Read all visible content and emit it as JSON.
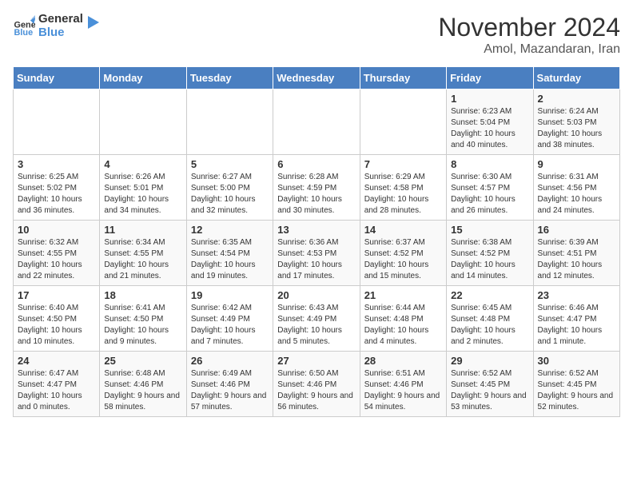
{
  "header": {
    "logo_general": "General",
    "logo_blue": "Blue",
    "month": "November 2024",
    "location": "Amol, Mazandaran, Iran"
  },
  "days_of_week": [
    "Sunday",
    "Monday",
    "Tuesday",
    "Wednesday",
    "Thursday",
    "Friday",
    "Saturday"
  ],
  "weeks": [
    [
      {
        "day": "",
        "info": ""
      },
      {
        "day": "",
        "info": ""
      },
      {
        "day": "",
        "info": ""
      },
      {
        "day": "",
        "info": ""
      },
      {
        "day": "",
        "info": ""
      },
      {
        "day": "1",
        "info": "Sunrise: 6:23 AM\nSunset: 5:04 PM\nDaylight: 10 hours and 40 minutes."
      },
      {
        "day": "2",
        "info": "Sunrise: 6:24 AM\nSunset: 5:03 PM\nDaylight: 10 hours and 38 minutes."
      }
    ],
    [
      {
        "day": "3",
        "info": "Sunrise: 6:25 AM\nSunset: 5:02 PM\nDaylight: 10 hours and 36 minutes."
      },
      {
        "day": "4",
        "info": "Sunrise: 6:26 AM\nSunset: 5:01 PM\nDaylight: 10 hours and 34 minutes."
      },
      {
        "day": "5",
        "info": "Sunrise: 6:27 AM\nSunset: 5:00 PM\nDaylight: 10 hours and 32 minutes."
      },
      {
        "day": "6",
        "info": "Sunrise: 6:28 AM\nSunset: 4:59 PM\nDaylight: 10 hours and 30 minutes."
      },
      {
        "day": "7",
        "info": "Sunrise: 6:29 AM\nSunset: 4:58 PM\nDaylight: 10 hours and 28 minutes."
      },
      {
        "day": "8",
        "info": "Sunrise: 6:30 AM\nSunset: 4:57 PM\nDaylight: 10 hours and 26 minutes."
      },
      {
        "day": "9",
        "info": "Sunrise: 6:31 AM\nSunset: 4:56 PM\nDaylight: 10 hours and 24 minutes."
      }
    ],
    [
      {
        "day": "10",
        "info": "Sunrise: 6:32 AM\nSunset: 4:55 PM\nDaylight: 10 hours and 22 minutes."
      },
      {
        "day": "11",
        "info": "Sunrise: 6:34 AM\nSunset: 4:55 PM\nDaylight: 10 hours and 21 minutes."
      },
      {
        "day": "12",
        "info": "Sunrise: 6:35 AM\nSunset: 4:54 PM\nDaylight: 10 hours and 19 minutes."
      },
      {
        "day": "13",
        "info": "Sunrise: 6:36 AM\nSunset: 4:53 PM\nDaylight: 10 hours and 17 minutes."
      },
      {
        "day": "14",
        "info": "Sunrise: 6:37 AM\nSunset: 4:52 PM\nDaylight: 10 hours and 15 minutes."
      },
      {
        "day": "15",
        "info": "Sunrise: 6:38 AM\nSunset: 4:52 PM\nDaylight: 10 hours and 14 minutes."
      },
      {
        "day": "16",
        "info": "Sunrise: 6:39 AM\nSunset: 4:51 PM\nDaylight: 10 hours and 12 minutes."
      }
    ],
    [
      {
        "day": "17",
        "info": "Sunrise: 6:40 AM\nSunset: 4:50 PM\nDaylight: 10 hours and 10 minutes."
      },
      {
        "day": "18",
        "info": "Sunrise: 6:41 AM\nSunset: 4:50 PM\nDaylight: 10 hours and 9 minutes."
      },
      {
        "day": "19",
        "info": "Sunrise: 6:42 AM\nSunset: 4:49 PM\nDaylight: 10 hours and 7 minutes."
      },
      {
        "day": "20",
        "info": "Sunrise: 6:43 AM\nSunset: 4:49 PM\nDaylight: 10 hours and 5 minutes."
      },
      {
        "day": "21",
        "info": "Sunrise: 6:44 AM\nSunset: 4:48 PM\nDaylight: 10 hours and 4 minutes."
      },
      {
        "day": "22",
        "info": "Sunrise: 6:45 AM\nSunset: 4:48 PM\nDaylight: 10 hours and 2 minutes."
      },
      {
        "day": "23",
        "info": "Sunrise: 6:46 AM\nSunset: 4:47 PM\nDaylight: 10 hours and 1 minute."
      }
    ],
    [
      {
        "day": "24",
        "info": "Sunrise: 6:47 AM\nSunset: 4:47 PM\nDaylight: 10 hours and 0 minutes."
      },
      {
        "day": "25",
        "info": "Sunrise: 6:48 AM\nSunset: 4:46 PM\nDaylight: 9 hours and 58 minutes."
      },
      {
        "day": "26",
        "info": "Sunrise: 6:49 AM\nSunset: 4:46 PM\nDaylight: 9 hours and 57 minutes."
      },
      {
        "day": "27",
        "info": "Sunrise: 6:50 AM\nSunset: 4:46 PM\nDaylight: 9 hours and 56 minutes."
      },
      {
        "day": "28",
        "info": "Sunrise: 6:51 AM\nSunset: 4:46 PM\nDaylight: 9 hours and 54 minutes."
      },
      {
        "day": "29",
        "info": "Sunrise: 6:52 AM\nSunset: 4:45 PM\nDaylight: 9 hours and 53 minutes."
      },
      {
        "day": "30",
        "info": "Sunrise: 6:52 AM\nSunset: 4:45 PM\nDaylight: 9 hours and 52 minutes."
      }
    ]
  ]
}
